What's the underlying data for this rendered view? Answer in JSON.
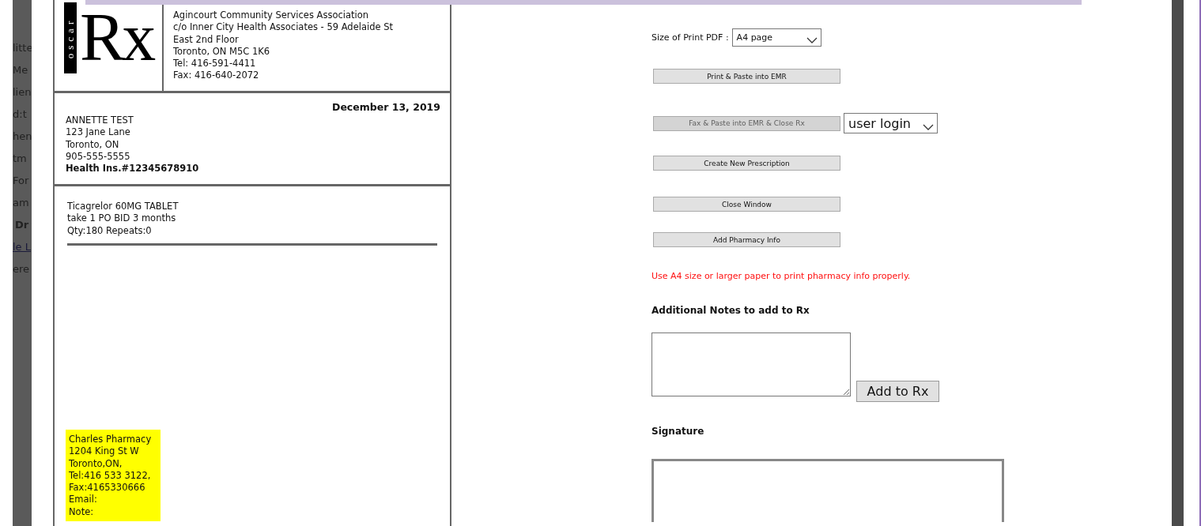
{
  "background_fragments": [
    {
      "text": "litte",
      "kind": "text"
    },
    {
      "text": "Me",
      "kind": "text"
    },
    {
      "text": "lien",
      "kind": "text"
    },
    {
      "text": "d:t",
      "kind": "text"
    },
    {
      "text": "hen",
      "kind": "text"
    },
    {
      "text": "tm",
      "kind": "text"
    },
    {
      "text": "For",
      "kind": "text"
    },
    {
      "text": "am",
      "kind": "text"
    },
    {
      "text": "Dr",
      "kind": "heading"
    },
    {
      "text": "le L",
      "kind": "link"
    },
    {
      "text": "ere",
      "kind": "text"
    }
  ],
  "prescription": {
    "logo": {
      "side_text": "oscar",
      "mark": "Rx"
    },
    "clinic_lines": [
      "Agincourt Community Services Association",
      "c/o Inner City Health Associates - 59 Adelaide St",
      "East 2nd Floor",
      "Toronto, ON M5C 1K6",
      "Tel: 416-591-4411",
      "Fax: 416-640-2072"
    ],
    "date": "December 13, 2019",
    "patient_lines": [
      "ANNETTE TEST",
      "123 Jane Lane",
      "Toronto, ON",
      "905-555-5555"
    ],
    "health_ins": "Health Ins.#12345678910",
    "drug_lines": [
      "Ticagrelor 60MG TABLET",
      "take 1 PO BID 3 months",
      "Qty:180 Repeats:0"
    ],
    "pharmacy_lines": [
      "Charles Pharmacy",
      "1204 King St W",
      "Toronto,ON,",
      "Tel:416 533 3122,",
      "Fax:4165330666",
      "Email:",
      "Note:"
    ]
  },
  "controls": {
    "size_label": "Size of Print PDF :",
    "size_select": "A4 page",
    "actions": [
      {
        "label": "Print & Paste into EMR",
        "disabled": false
      },
      {
        "label": "Fax & Paste into EMR & Close Rx",
        "disabled": true,
        "select": "user login"
      },
      {
        "label": "Create New Prescription",
        "disabled": false
      },
      {
        "label": "Close Window",
        "disabled": false
      },
      {
        "label": "Add Pharmacy Info",
        "disabled": false
      }
    ],
    "warning": "Use A4 size or larger paper to print pharmacy info properly.",
    "notes_heading": "Additional Notes to add to Rx",
    "add_button": "Add to Rx",
    "signature_heading": "Signature"
  }
}
